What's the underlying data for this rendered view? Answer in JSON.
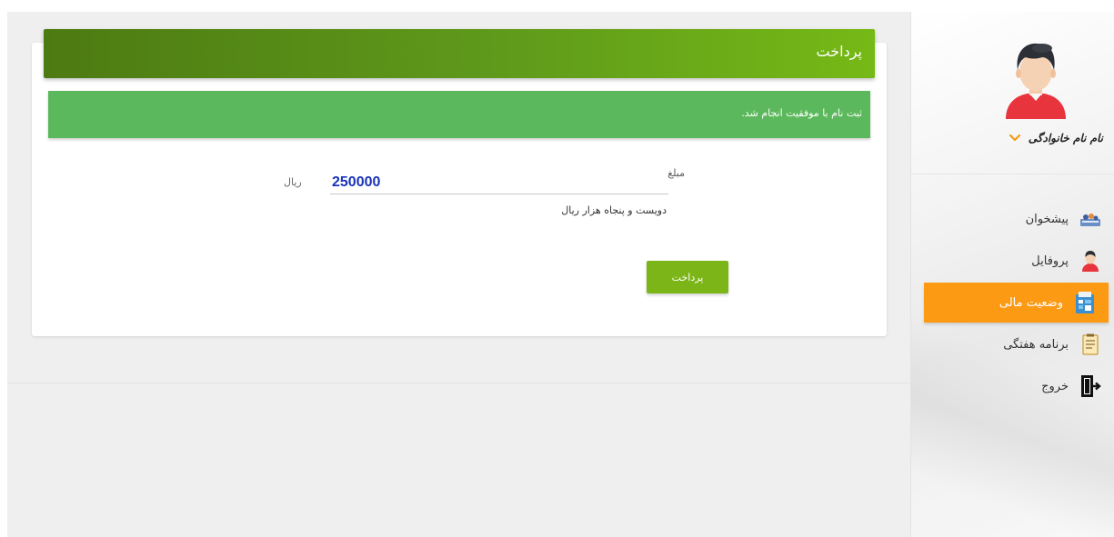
{
  "sidebar": {
    "user_name": "نام نام خانوادگی",
    "items": [
      {
        "label": "پیشخوان",
        "icon": "dashboard-icon",
        "active": false
      },
      {
        "label": "پروفایل",
        "icon": "profile-icon",
        "active": false
      },
      {
        "label": "وضعیت مالی",
        "icon": "finance-icon",
        "active": true
      },
      {
        "label": "برنامه هفتگی",
        "icon": "schedule-icon",
        "active": false
      },
      {
        "label": "خروج",
        "icon": "logout-icon",
        "active": false
      }
    ]
  },
  "payment": {
    "title": "پرداخت",
    "alert": "ثبت نام با موفقیت انجام شد.",
    "amount_label": "مبلغ",
    "amount_value": "250000",
    "amount_unit": "ریال",
    "amount_words": "دویست و پنجاه هزار ریال",
    "pay_button": "پرداخت"
  },
  "colors": {
    "header_gradient_start": "#76b916",
    "header_gradient_end": "#4d7a12",
    "alert_bg": "#5cb85c",
    "active_nav": "#fd9a14",
    "pay_button": "#7cb518",
    "amount_text": "#1a33b8"
  }
}
